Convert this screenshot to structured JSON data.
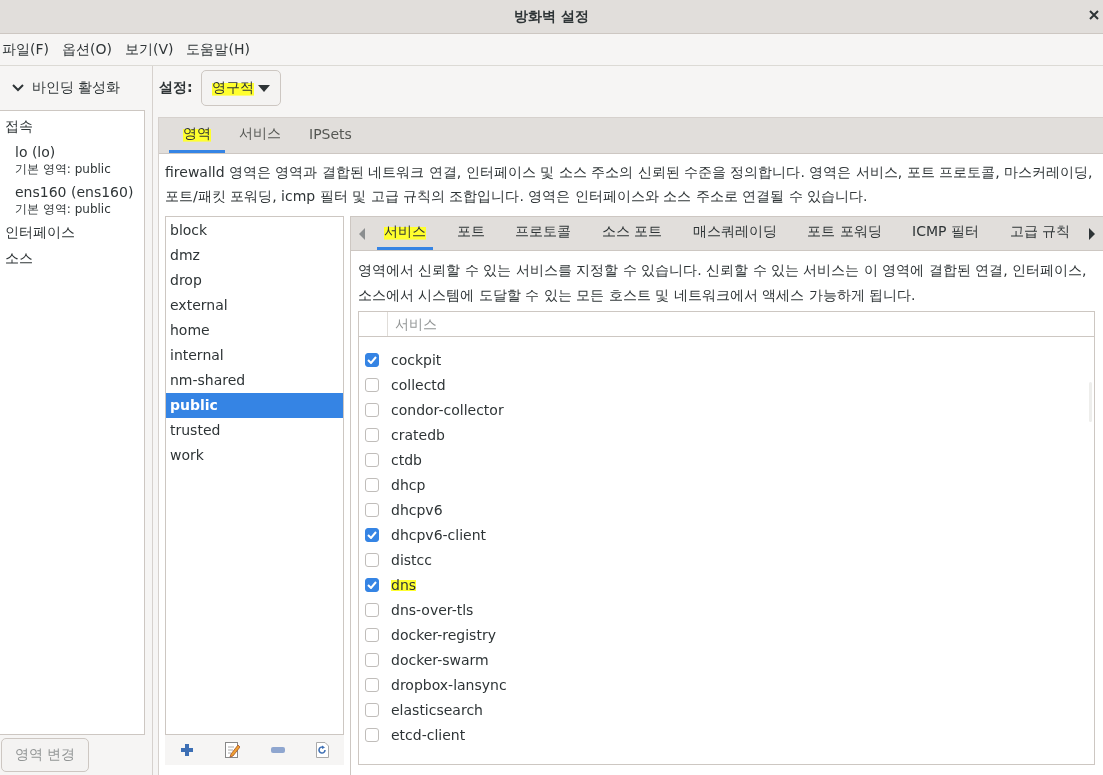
{
  "window": {
    "title": "방화벽 설정"
  },
  "menu": [
    "파일(F)",
    "옵션(O)",
    "보기(V)",
    "도움말(H)"
  ],
  "sidebar": {
    "header": {
      "label": "바인딩 활성화",
      "expanded": true
    },
    "sections": [
      {
        "label": "접속",
        "items": [
          {
            "name": "lo (lo)",
            "zone_label": "기본 영역:",
            "zone": "public"
          },
          {
            "name": "ens160 (ens160)",
            "zone_label": "기본 영역:",
            "zone": "public"
          }
        ]
      },
      {
        "label": "인터페이스"
      },
      {
        "label": "소스"
      }
    ],
    "button": {
      "label": "영역 변경",
      "disabled": true
    }
  },
  "configuration": {
    "label": "설정:",
    "value": "영구적",
    "highlighted": true
  },
  "tabs": [
    {
      "label": "영역",
      "selected": true,
      "highlighted": true
    },
    {
      "label": "서비스",
      "selected": false,
      "highlighted": false
    },
    {
      "label": "IPSets",
      "selected": false,
      "highlighted": false
    }
  ],
  "zone_description": "firewalld 영역은 영역과 결합된 네트워크 연결, 인터페이스 및 소스 주소의 신뢰된 수준을 정의합니다. 영역은 서비스, 포트 프로토콜, 마스커레이딩, 포트/패킷 포워딩, icmp 필터 및 고급 규칙의 조합입니다. 영역은 인터페이스와 소스 주소로 연결될 수 있습니다.",
  "zones": [
    {
      "name": "block",
      "selected": false
    },
    {
      "name": "dmz",
      "selected": false
    },
    {
      "name": "drop",
      "selected": false
    },
    {
      "name": "external",
      "selected": false
    },
    {
      "name": "home",
      "selected": false
    },
    {
      "name": "internal",
      "selected": false
    },
    {
      "name": "nm-shared",
      "selected": false
    },
    {
      "name": "public",
      "selected": true
    },
    {
      "name": "trusted",
      "selected": false
    },
    {
      "name": "work",
      "selected": false
    }
  ],
  "subtabs": [
    {
      "label": "서비스",
      "selected": true,
      "highlighted": true
    },
    {
      "label": "포트",
      "selected": false,
      "highlighted": false
    },
    {
      "label": "프로토콜",
      "selected": false,
      "highlighted": false
    },
    {
      "label": "소스 포트",
      "selected": false,
      "highlighted": false
    },
    {
      "label": "매스쿼레이딩",
      "selected": false,
      "highlighted": false
    },
    {
      "label": "포트 포워딩",
      "selected": false,
      "highlighted": false
    },
    {
      "label": "ICMP 필터",
      "selected": false,
      "highlighted": false
    },
    {
      "label": "고급 규칙",
      "selected": false,
      "highlighted": false
    }
  ],
  "services_description": "영역에서 신뢰할 수 있는 서비스를 지정할 수 있습니다. 신뢰할 수 있는 서비스는 이 영역에 결합된 연결, 인터페이스, 소스에서 시스템에 도달할 수 있는 모든 호스트 및 네트워크에서 액세스 가능하게 됩니다.",
  "services_table": {
    "column": "서비스",
    "rows": [
      {
        "name": "cockpit",
        "checked": true,
        "highlighted": false
      },
      {
        "name": "collectd",
        "checked": false,
        "highlighted": false
      },
      {
        "name": "condor-collector",
        "checked": false,
        "highlighted": false
      },
      {
        "name": "cratedb",
        "checked": false,
        "highlighted": false
      },
      {
        "name": "ctdb",
        "checked": false,
        "highlighted": false
      },
      {
        "name": "dhcp",
        "checked": false,
        "highlighted": false
      },
      {
        "name": "dhcpv6",
        "checked": false,
        "highlighted": false
      },
      {
        "name": "dhcpv6-client",
        "checked": true,
        "highlighted": false
      },
      {
        "name": "distcc",
        "checked": false,
        "highlighted": false
      },
      {
        "name": "dns",
        "checked": true,
        "highlighted": true
      },
      {
        "name": "dns-over-tls",
        "checked": false,
        "highlighted": false
      },
      {
        "name": "docker-registry",
        "checked": false,
        "highlighted": false
      },
      {
        "name": "docker-swarm",
        "checked": false,
        "highlighted": false
      },
      {
        "name": "dropbox-lansync",
        "checked": false,
        "highlighted": false
      },
      {
        "name": "elasticsearch",
        "checked": false,
        "highlighted": false
      },
      {
        "name": "etcd-client",
        "checked": false,
        "highlighted": false
      }
    ]
  }
}
